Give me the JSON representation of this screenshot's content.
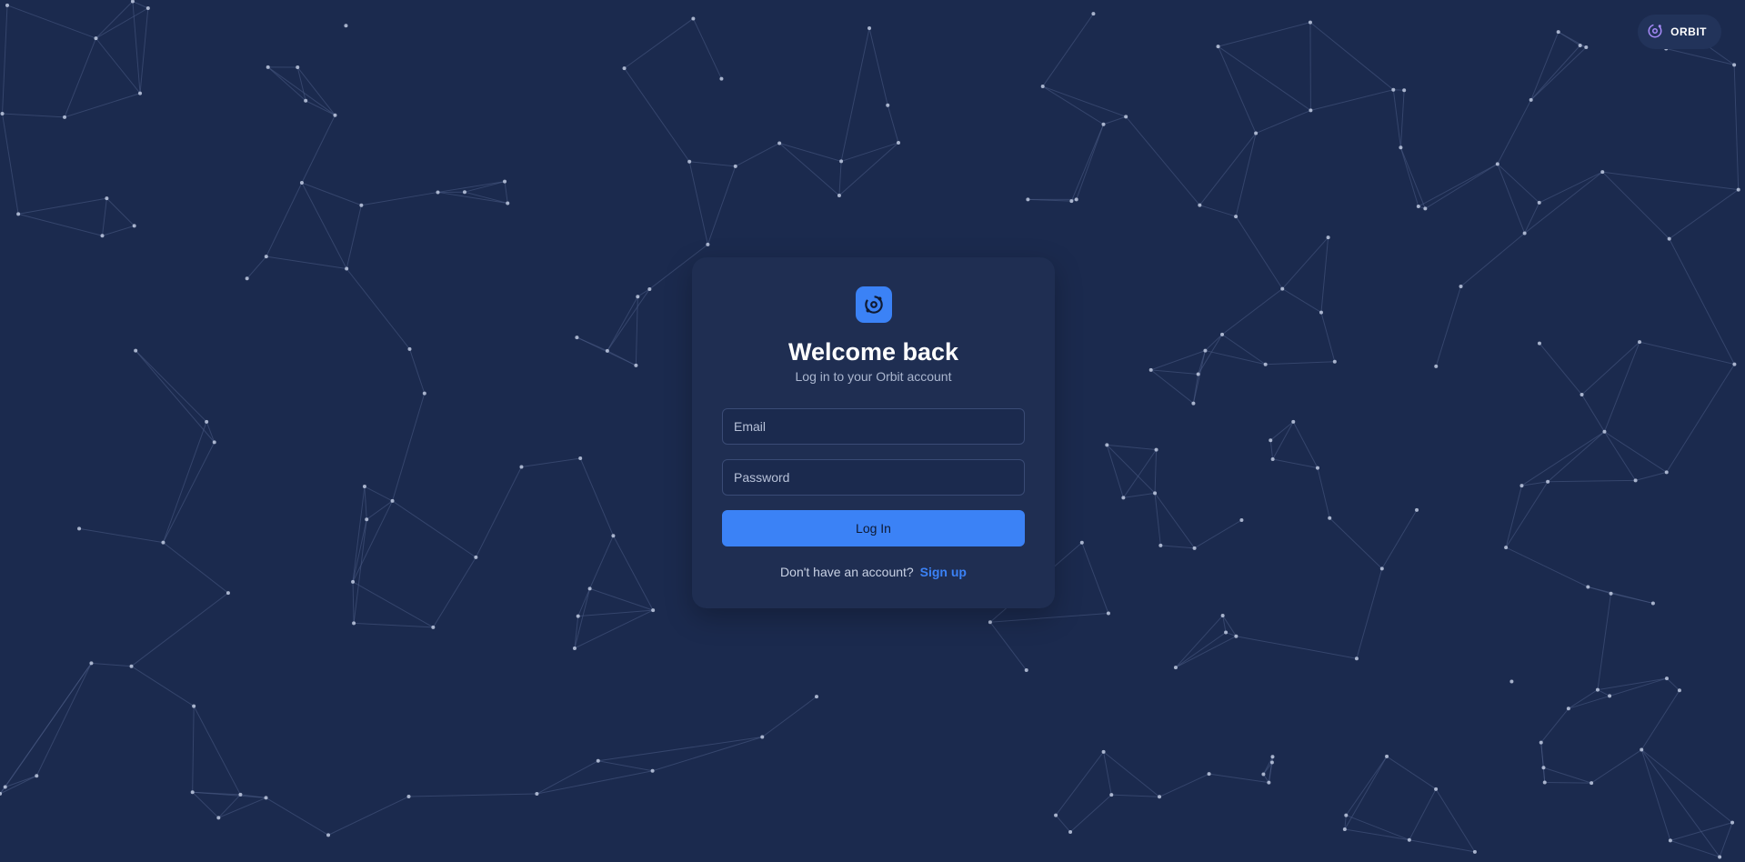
{
  "brand": {
    "name": "ORBIT",
    "icon": "orbit-icon",
    "accent": "#a78bfa"
  },
  "login_card": {
    "logo_icon": "orbit-logo-icon",
    "title": "Welcome back",
    "subtitle": "Log in to your Orbit account",
    "email": {
      "placeholder": "Email",
      "value": ""
    },
    "password": {
      "placeholder": "Password",
      "value": ""
    },
    "submit_label": "Log In",
    "signup_prompt": "Don't have an account?",
    "signup_link": "Sign up"
  },
  "colors": {
    "background": "#1b2a4e",
    "card": "#1f2e52",
    "primary": "#3b82f6",
    "network_lines": "#4a5b85",
    "network_nodes": "#c9d3ea"
  }
}
